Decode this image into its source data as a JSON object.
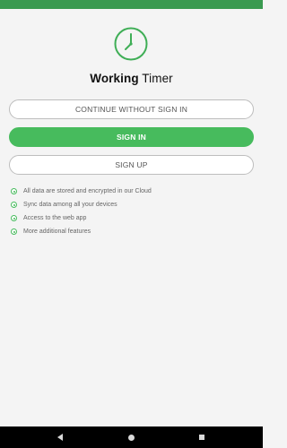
{
  "app": {
    "title_bold": "Working",
    "title_rest": " Timer"
  },
  "buttons": {
    "continue_label": "CONTINUE WITHOUT SIGN IN",
    "signin_label": "SIGN IN",
    "signup_label": "SIGN UP"
  },
  "features": [
    "All data are stored and encrypted in our Cloud",
    "Sync data among all your devices",
    "Access to the web app",
    "More additional features"
  ],
  "colors": {
    "status_bar": "#3a9a50",
    "accent": "#47bb5d",
    "background": "#f4f4f4",
    "nav_bar": "#000000"
  },
  "icons": {
    "logo": "clock-icon",
    "bullet": "radio-dot-icon",
    "nav_back": "back-triangle-icon",
    "nav_home": "home-circle-icon",
    "nav_recent": "recents-square-icon"
  }
}
